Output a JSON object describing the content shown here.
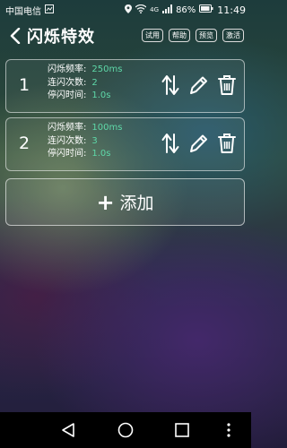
{
  "status_bar": {
    "carrier": "中国电信",
    "network": "4G",
    "battery_percent": "86%",
    "time": "11:49"
  },
  "header": {
    "title": "闪烁特效",
    "actions": [
      "试用",
      "帮助",
      "预览",
      "激活"
    ]
  },
  "effects": [
    {
      "index": "1",
      "params": [
        {
          "label": "闪烁频率:",
          "value": "250ms"
        },
        {
          "label": "连闪次数:",
          "value": "2"
        },
        {
          "label": "停闪时间:",
          "value": "1.0s"
        }
      ]
    },
    {
      "index": "2",
      "params": [
        {
          "label": "闪烁频率:",
          "value": "100ms"
        },
        {
          "label": "连闪次数:",
          "value": "3"
        },
        {
          "label": "停闪时间:",
          "value": "1.0s"
        }
      ]
    }
  ],
  "add_button": {
    "plus": "+",
    "label": "添加"
  },
  "colors": {
    "accent_value": "#5ed8a8",
    "border": "#dcdcdc"
  },
  "icons": {
    "card_actions": [
      "reorder-arrows-icon",
      "edit-pencil-icon",
      "delete-trash-icon"
    ],
    "nav": [
      "back-triangle-icon",
      "home-circle-icon",
      "recents-square-icon",
      "menu-dots-icon"
    ]
  }
}
